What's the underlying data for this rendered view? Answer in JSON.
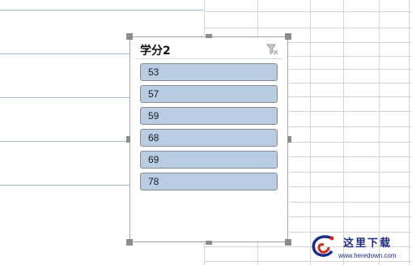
{
  "slicer": {
    "title": "学分2",
    "clear_filter_icon": "clear-filter-icon",
    "items": [
      "53",
      "57",
      "59",
      "68",
      "69",
      "78"
    ]
  },
  "watermark": {
    "text": "这里下载",
    "url": "www.heredown.com"
  },
  "colors": {
    "item_fill": "#b8cce4",
    "gridline_blue": "#9fb9d6",
    "gridline_gray": "#d4d4d4",
    "logo_blue": "#1b2c86",
    "logo_red": "#d9261c"
  }
}
